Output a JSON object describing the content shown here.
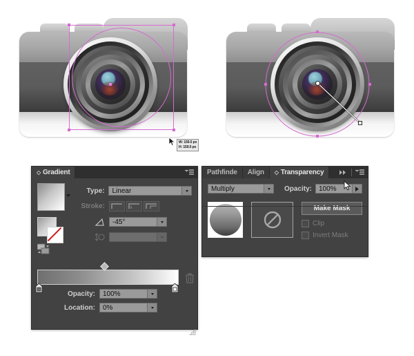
{
  "artboard": {
    "left_camera": {
      "name": "camera-illustration-selected-bounds",
      "selection_tooltip": {
        "width": "W: 159.5 px",
        "height": "H: 159.5 px"
      }
    },
    "right_camera": {
      "name": "camera-illustration-gradient-annotator"
    }
  },
  "gradient_panel": {
    "tabs": [
      {
        "label": "Gradient",
        "active": true
      }
    ],
    "type_label": "Type:",
    "type_value": "Linear",
    "stroke_label": "Stroke:",
    "angle_value": "-45°",
    "aspect_value": "",
    "opacity_label": "Opacity:",
    "opacity_value": "100%",
    "location_label": "Location:",
    "location_value": "0%",
    "ramp": {
      "start_color": "#6f6f6f",
      "end_color": "#ffffff",
      "midpoint_percent": 50
    }
  },
  "transparency_panel": {
    "tabs": [
      {
        "label": "Pathfinde",
        "active": false
      },
      {
        "label": "Align",
        "active": false
      },
      {
        "label": "Transparency",
        "active": true
      }
    ],
    "blend_mode": "Multiply",
    "opacity_label": "Opacity:",
    "opacity_value": "100%",
    "make_mask_label": "Make Mask",
    "clip_label": "Clip",
    "invert_mask_label": "Invert Mask"
  },
  "colors": {
    "panel_bg": "#424242",
    "tab_bg": "#2f2f2f",
    "selection_magenta": "#d56bd0",
    "field_bg": "#9a9a9a"
  }
}
